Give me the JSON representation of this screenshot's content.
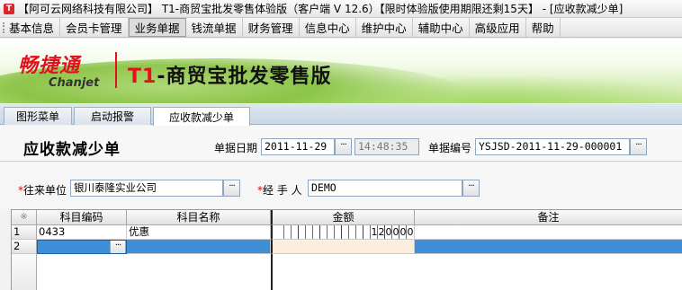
{
  "window": {
    "title": "【阿可云网络科技有限公司】 T1-商贸宝批发零售体验版（客户端 V 12.6）【限时体验版使用期限还剩15天】 - [应收款减少单]"
  },
  "menu": {
    "items": [
      "基本信息",
      "会员卡管理",
      "业务单据",
      "钱流单据",
      "财务管理",
      "信息中心",
      "维护中心",
      "辅助中心",
      "高级应用",
      "帮助"
    ],
    "active": "业务单据"
  },
  "banner": {
    "logo_cn": "畅捷通",
    "logo_en": "Chanjet",
    "product_prefix": "T1",
    "product_rest": "-商贸宝批发零售版"
  },
  "tabs": [
    "图形菜单",
    "启动报警",
    "应收款减少单"
  ],
  "form": {
    "title": "应收款减少单",
    "date_label": "单据日期",
    "date_value": "2011-11-29",
    "time_value": "14:48:35",
    "number_label": "单据编号",
    "number_value": "YSJSD-2011-11-29-000001",
    "partner_label": "往来单位",
    "partner_value": "银川泰隆实业公司",
    "handler_label": "经 手 人",
    "handler_value": "DEMO",
    "required_mark": "*",
    "ellipsis": "···"
  },
  "grid": {
    "corner": "※",
    "columns": [
      "科目编码",
      "科目名称",
      "金额",
      "备注"
    ],
    "rows": [
      {
        "no": "1",
        "code": "0433",
        "name": "优惠",
        "amount_digits": [
          "1",
          "2",
          "0",
          "0",
          "0",
          "0"
        ],
        "note": ""
      },
      {
        "no": "2",
        "code": "",
        "name": "",
        "amount_digits": [],
        "note": ""
      }
    ]
  },
  "colors": {
    "selected_row": "#3e8ed8",
    "brand_red": "#e3101e",
    "banner_green": "#7fbd35"
  }
}
